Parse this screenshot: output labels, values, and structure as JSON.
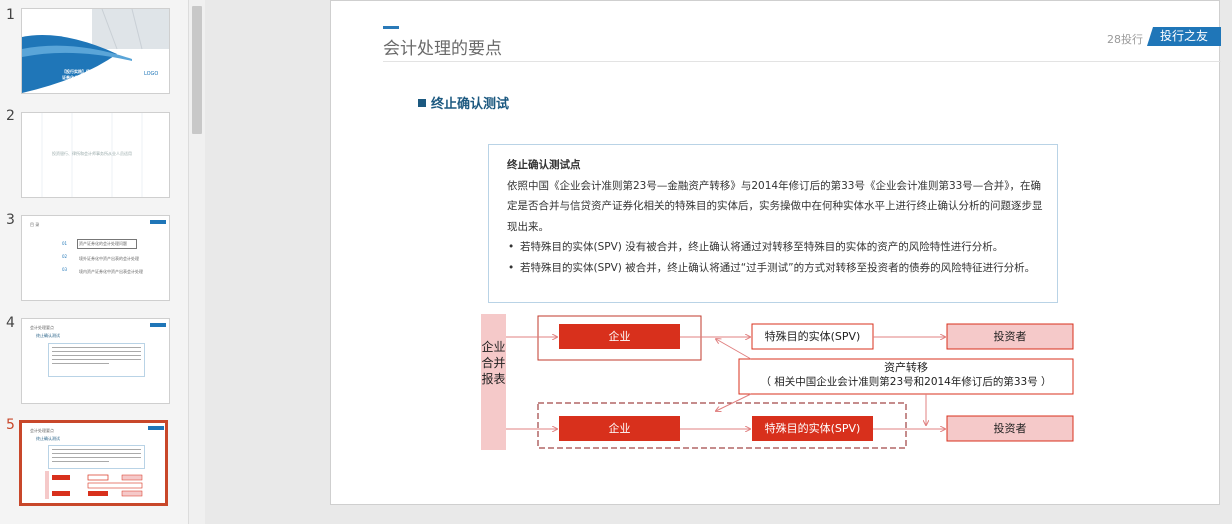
{
  "thumbnails": [
    {
      "number": "1",
      "lines": [
        "【投行实践】债权金融资产",
        "证券化会计处理"
      ],
      "logo": "LOGO"
    },
    {
      "number": "2",
      "lines": [
        "投资银行、律所和会计师事务所从业人员适用"
      ]
    },
    {
      "number": "3",
      "lines": [
        "目 录",
        "01",
        "02",
        "03",
        "资产证券化的会计处理问题",
        "境外证券化中资产出表的会计处理",
        "境内资产证券化中资产出表会计处理"
      ]
    },
    {
      "number": "4",
      "lines": [
        "会计处理要点",
        "终止确认测试"
      ]
    },
    {
      "number": "5",
      "lines": [
        "会计处理要点",
        "终止确认测试"
      ]
    }
  ],
  "slide": {
    "title": "会计处理的要点",
    "brand_gray": "28投行",
    "brand_tab": "投行之友",
    "section_heading": "终止确认测试",
    "box_heading": "终止确认测试点",
    "paragraph": "依照中国《企业会计准则第23号—金融资产转移》与2014年修订后的第33号《企业会计准则第33号—合并》，在确定是否合并与信贷资产证券化相关的特殊目的实体后，实务操做中在何种实体水平上进行终止确认分析的问题逐步显现出来。",
    "bullets": [
      "若特殊目的实体(SPV) 没有被合并，终止确认将通过对转移至特殊目的实体的资产的风险特性进行分析。",
      "若特殊目的实体(SPV) 被合并，终止确认将通过“过手测试”的方式对转移至投资者的债券的风险特征进行分析。"
    ],
    "diagram": {
      "side_label": "企业合并报表",
      "enterprise_top": "企业",
      "spv_top": "特殊目的实体(SPV)",
      "investor_top": "投资者",
      "transfer_label": "资产转移",
      "transfer_note": "（ 相关中国企业会计准则第23号和2014年修订后的第33号 ）",
      "enterprise_bottom": "企业",
      "spv_bottom": "特殊目的实体(SPV)",
      "investor_bottom": "投资者"
    }
  },
  "colors": {
    "accent": "#1f76b8",
    "red": "#d8301c",
    "pink": "#f5c9c9",
    "selection": "#c8472a"
  }
}
